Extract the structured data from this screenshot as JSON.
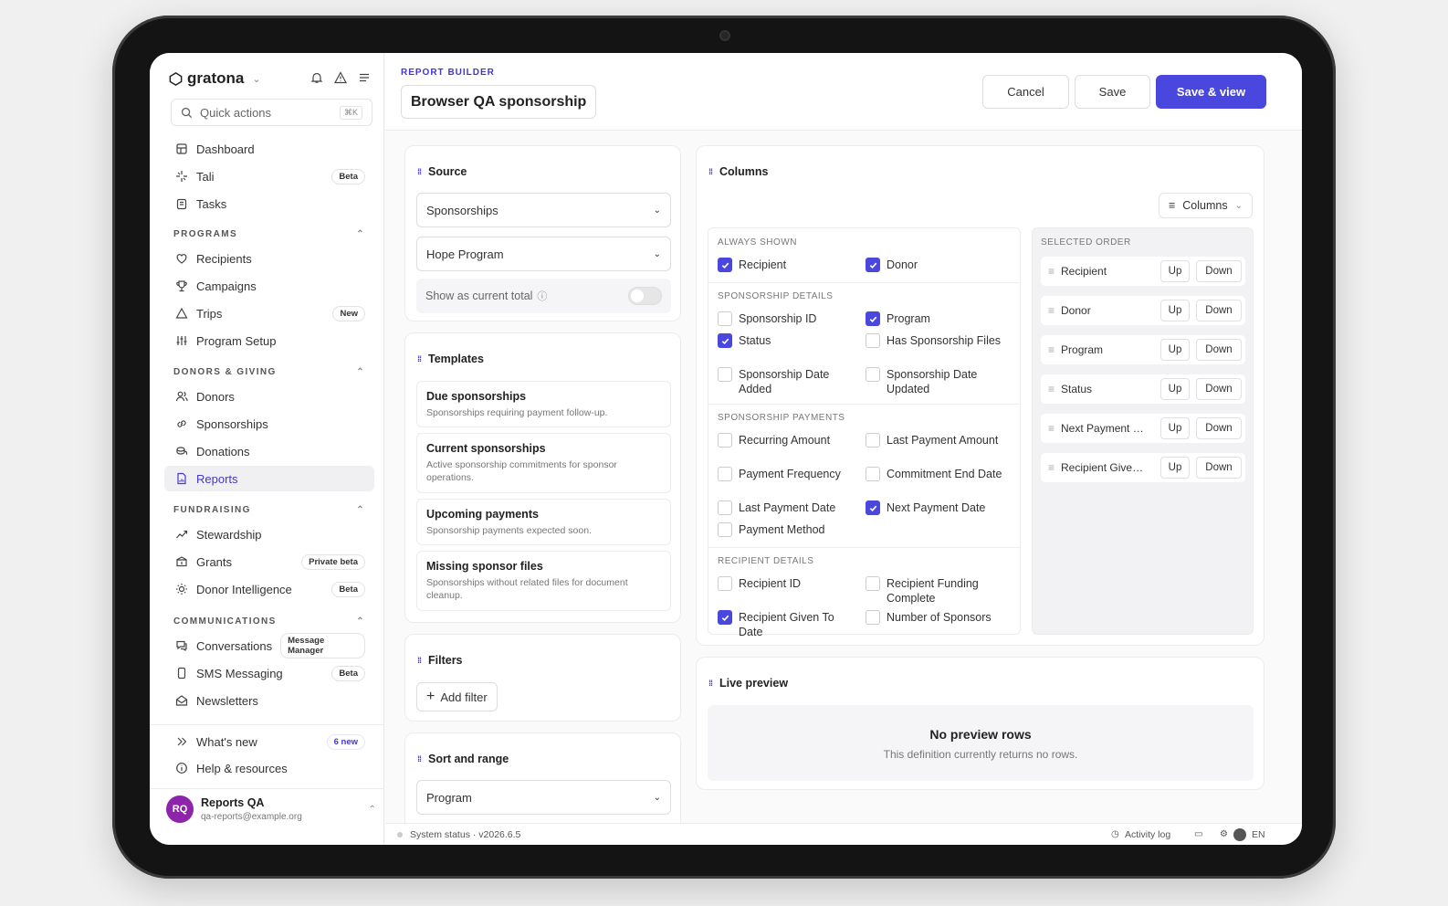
{
  "app": {
    "logo": "gratona",
    "quick_actions": {
      "placeholder": "Quick actions",
      "shortcut": "⌘K"
    }
  },
  "sidebar": {
    "top_items": [
      {
        "label": "Dashboard",
        "icon": "dashboard-icon"
      },
      {
        "label": "Tali",
        "icon": "sparkle-icon",
        "badge": "Beta"
      },
      {
        "label": "Tasks",
        "icon": "clipboard-icon"
      }
    ],
    "sections": [
      {
        "title": "PROGRAMS",
        "items": [
          {
            "label": "Recipients",
            "icon": "heart-icon"
          },
          {
            "label": "Campaigns",
            "icon": "trophy-icon"
          },
          {
            "label": "Trips",
            "icon": "triangle-icon",
            "badge": "New"
          },
          {
            "label": "Program Setup",
            "icon": "sliders-icon"
          }
        ]
      },
      {
        "title": "DONORS & GIVING",
        "items": [
          {
            "label": "Donors",
            "icon": "users-icon"
          },
          {
            "label": "Sponsorships",
            "icon": "link-icon"
          },
          {
            "label": "Donations",
            "icon": "coins-icon"
          },
          {
            "label": "Reports",
            "icon": "report-icon",
            "active": true
          }
        ]
      },
      {
        "title": "FUNDRAISING",
        "items": [
          {
            "label": "Stewardship",
            "icon": "trend-icon"
          },
          {
            "label": "Grants",
            "icon": "grant-icon",
            "badge": "Private beta"
          },
          {
            "label": "Donor Intelligence",
            "icon": "bulb-icon",
            "badge": "Beta"
          }
        ]
      },
      {
        "title": "COMMUNICATIONS",
        "items": [
          {
            "label": "Conversations",
            "icon": "chat-icon",
            "badge": "Message Manager"
          },
          {
            "label": "SMS Messaging",
            "icon": "phone-icon",
            "badge": "Beta"
          },
          {
            "label": "Newsletters",
            "icon": "mail-icon"
          }
        ]
      }
    ],
    "footer_items": [
      {
        "label": "What's new",
        "icon": "chevrons-right-icon",
        "badge": "6 new"
      },
      {
        "label": "Help & resources",
        "icon": "info-icon"
      }
    ],
    "user": {
      "initials": "RQ",
      "name": "Reports QA",
      "email": "qa-reports@example.org"
    }
  },
  "header": {
    "eyebrow": "REPORT BUILDER",
    "title": "Browser QA sponsorship",
    "cancel": "Cancel",
    "save": "Save",
    "save_view": "Save & view"
  },
  "source": {
    "title": "Source",
    "entity": "Sponsorships",
    "program": "Hope Program",
    "toggle_label": "Show as current total"
  },
  "templates": {
    "title": "Templates",
    "items": [
      {
        "title": "Due sponsorships",
        "desc": "Sponsorships requiring payment follow-up."
      },
      {
        "title": "Current sponsorships",
        "desc": "Active sponsorship commitments for sponsor operations."
      },
      {
        "title": "Upcoming payments",
        "desc": "Sponsorship payments expected soon."
      },
      {
        "title": "Missing sponsor files",
        "desc": "Sponsorships without related files for document cleanup."
      }
    ]
  },
  "filters": {
    "title": "Filters",
    "add": "Add filter"
  },
  "sort": {
    "title": "Sort and range",
    "field": "Program"
  },
  "columns": {
    "title": "Columns",
    "button": "Columns",
    "groups": [
      {
        "title": "ALWAYS SHOWN",
        "items": [
          {
            "label": "Recipient",
            "checked": true
          },
          {
            "label": "Donor",
            "checked": true
          }
        ]
      },
      {
        "title": "SPONSORSHIP DETAILS",
        "items": [
          {
            "label": "Sponsorship ID",
            "checked": false
          },
          {
            "label": "Program",
            "checked": true
          },
          {
            "label": "Status",
            "checked": true
          },
          {
            "label": "Has Sponsorship Files",
            "checked": false
          },
          {
            "label": "Sponsorship Date Added",
            "checked": false
          },
          {
            "label": "Sponsorship Date Updated",
            "checked": false
          }
        ]
      },
      {
        "title": "SPONSORSHIP PAYMENTS",
        "items": [
          {
            "label": "Recurring Amount",
            "checked": false
          },
          {
            "label": "Last Payment Amount",
            "checked": false
          },
          {
            "label": "Payment Frequency",
            "checked": false
          },
          {
            "label": "Commitment End Date",
            "checked": false
          },
          {
            "label": "Last Payment Date",
            "checked": false
          },
          {
            "label": "Next Payment Date",
            "checked": true
          },
          {
            "label": "Payment Method",
            "checked": false
          }
        ]
      },
      {
        "title": "RECIPIENT DETAILS",
        "items": [
          {
            "label": "Recipient ID",
            "checked": false
          },
          {
            "label": "Recipient Funding Complete",
            "checked": false
          },
          {
            "label": "Recipient Given To Date",
            "checked": true
          },
          {
            "label": "Number of Sponsors",
            "checked": false
          }
        ]
      }
    ],
    "order_title": "SELECTED ORDER",
    "order": [
      "Recipient",
      "Donor",
      "Program",
      "Status",
      "Next Payment Date",
      "Recipient Given To Date"
    ],
    "up": "Up",
    "down": "Down"
  },
  "preview": {
    "title": "Live preview",
    "empty_title": "No preview rows",
    "empty_desc": "This definition currently returns no rows."
  },
  "statusbar": {
    "status": "System status · v2026.6.5",
    "activity": "Activity log",
    "lang": "EN"
  },
  "colors": {
    "accent": "#4a47de",
    "accent_text": "#4338ca"
  }
}
